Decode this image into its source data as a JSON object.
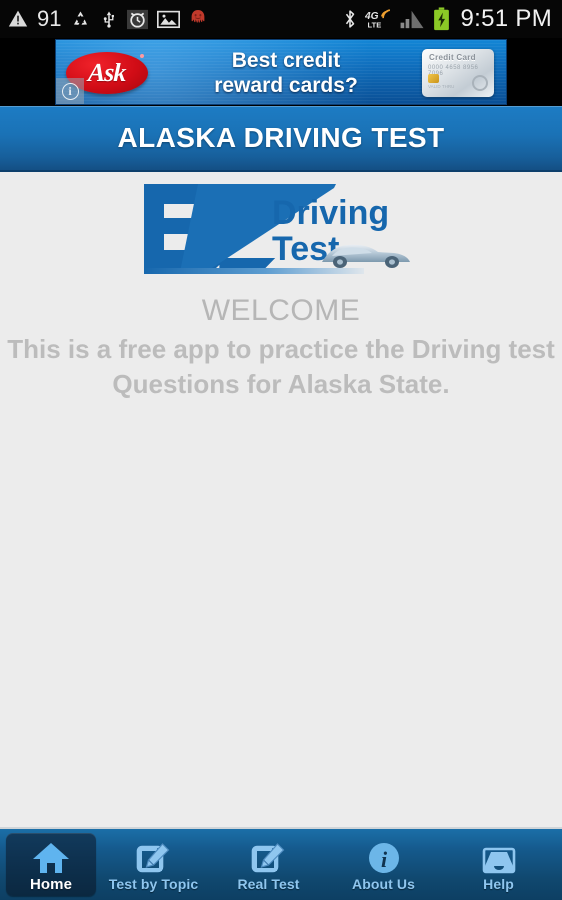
{
  "status_bar": {
    "battery_percent": "91",
    "time": "9:51 PM",
    "left_icons": [
      "warning-triangle-icon",
      "recycle-icon",
      "usb-icon",
      "alarm-clock-icon",
      "image-icon",
      "octopus-icon"
    ],
    "right_icons": [
      "bluetooth-icon",
      "4g-lte-icon",
      "signal-bars-icon",
      "battery-charging-icon"
    ]
  },
  "ad_banner": {
    "brand": "Ask",
    "line1": "Best credit",
    "line2": "reward cards?",
    "card_label": "Credit Card",
    "card_number": "0000 4658 8956 7096",
    "card_holder": "VALID THRU",
    "info_label": "i"
  },
  "header": {
    "title": "ALASKA DRIVING TEST"
  },
  "logo": {
    "monogram": "EZ",
    "word1": "Driving",
    "word2": "Test",
    "color": "#1667ad"
  },
  "main": {
    "welcome": "WELCOME",
    "description": "This is a free app to practice the Driving test Questions for Alaska State."
  },
  "nav": {
    "items": [
      {
        "label": "Home",
        "icon": "home-icon",
        "selected": true
      },
      {
        "label": "Test by Topic",
        "icon": "edit-square-icon",
        "selected": false
      },
      {
        "label": "Real Test",
        "icon": "edit-square-icon",
        "selected": false
      },
      {
        "label": "About Us",
        "icon": "info-circle-icon",
        "selected": false
      },
      {
        "label": "Help",
        "icon": "inbox-tray-icon",
        "selected": false
      }
    ]
  },
  "colors": {
    "accent_blue": "#1a72b6",
    "nav_blue": "#155a8d",
    "icon_blue": "#7cc0f0",
    "content_bg": "#ececec",
    "muted_text": "#bcbcbc"
  }
}
